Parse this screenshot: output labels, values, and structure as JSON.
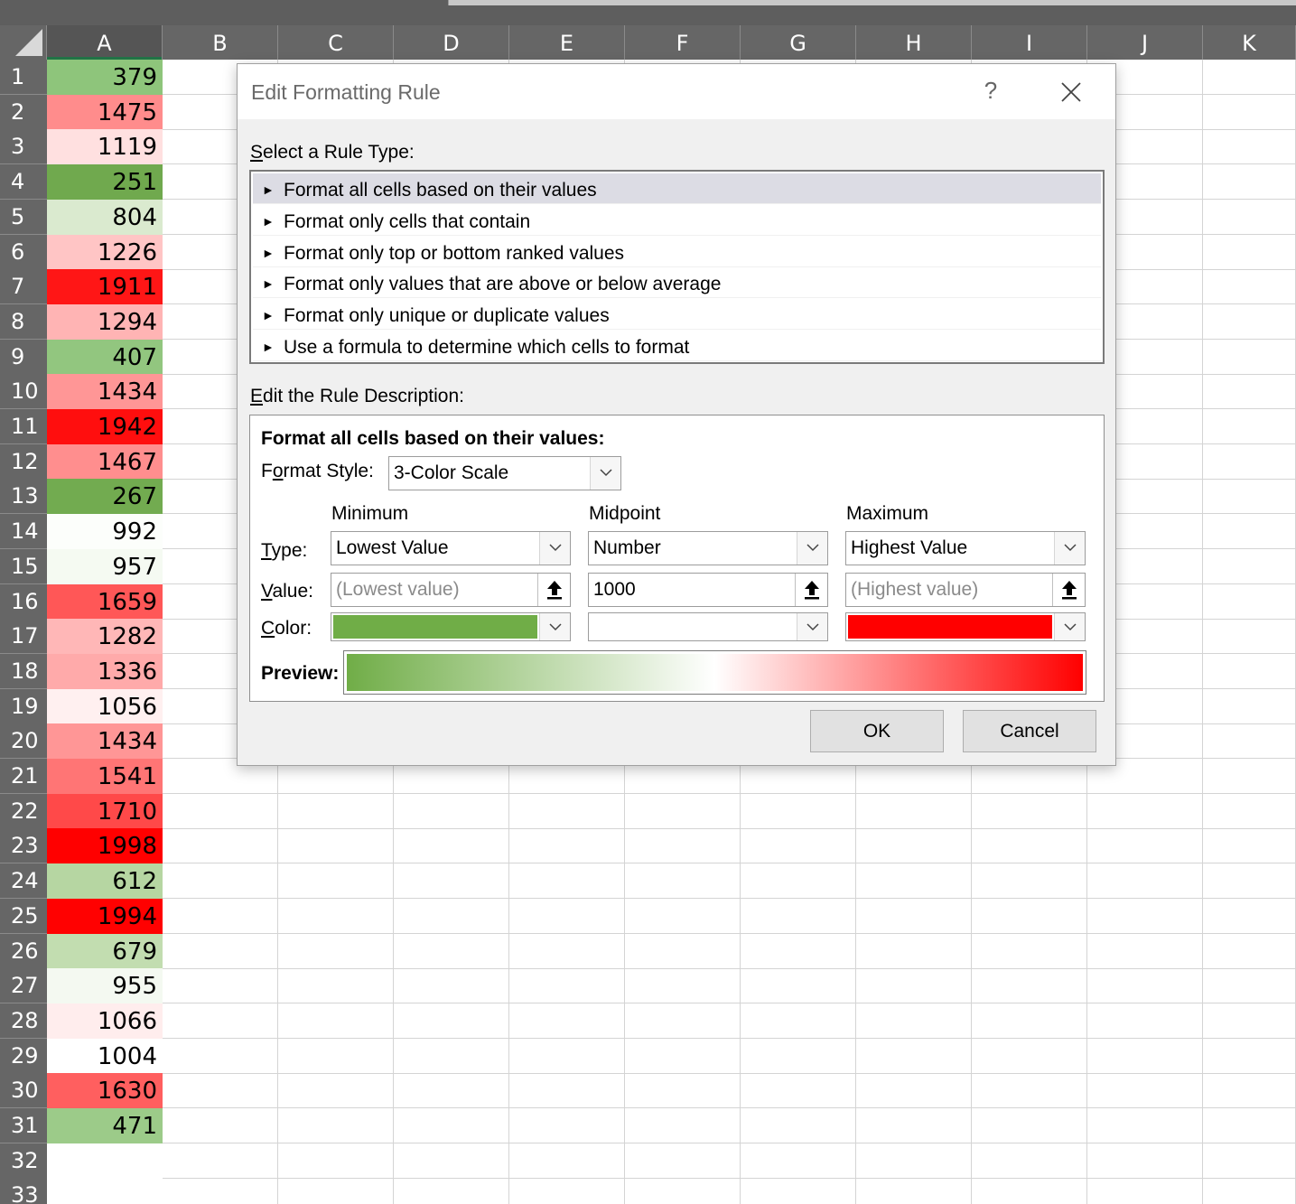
{
  "spreadsheet": {
    "columns": [
      "A",
      "B",
      "C",
      "D",
      "E",
      "F",
      "G",
      "H",
      "I",
      "J",
      "K"
    ],
    "rows": [
      {
        "n": "1",
        "value": "379",
        "color": "#8ec57b"
      },
      {
        "n": "2",
        "value": "1475",
        "color": "#ff8c8c"
      },
      {
        "n": "3",
        "value": "1119",
        "color": "#ffe0e0"
      },
      {
        "n": "4",
        "value": "251",
        "color": "#70a94e"
      },
      {
        "n": "5",
        "value": "804",
        "color": "#daeacf"
      },
      {
        "n": "6",
        "value": "1226",
        "color": "#ffc5c5"
      },
      {
        "n": "7",
        "value": "1911",
        "color": "#ff1616"
      },
      {
        "n": "8",
        "value": "1294",
        "color": "#ffb4b4"
      },
      {
        "n": "9",
        "value": "407",
        "color": "#92c67f"
      },
      {
        "n": "10",
        "value": "1434",
        "color": "#ff9696"
      },
      {
        "n": "11",
        "value": "1942",
        "color": "#ff0e0e"
      },
      {
        "n": "12",
        "value": "1467",
        "color": "#ff8e8e"
      },
      {
        "n": "13",
        "value": "267",
        "color": "#72ab50"
      },
      {
        "n": "14",
        "value": "992",
        "color": "#fcfefb"
      },
      {
        "n": "15",
        "value": "957",
        "color": "#f5faf2"
      },
      {
        "n": "16",
        "value": "1659",
        "color": "#ff5757"
      },
      {
        "n": "17",
        "value": "1282",
        "color": "#ffb7b7"
      },
      {
        "n": "18",
        "value": "1336",
        "color": "#ffaaaa"
      },
      {
        "n": "19",
        "value": "1056",
        "color": "#fff0f0"
      },
      {
        "n": "20",
        "value": "1434",
        "color": "#ff9696"
      },
      {
        "n": "21",
        "value": "1541",
        "color": "#ff7575"
      },
      {
        "n": "22",
        "value": "1710",
        "color": "#ff4949"
      },
      {
        "n": "23",
        "value": "1998",
        "color": "#ff0000"
      },
      {
        "n": "24",
        "value": "612",
        "color": "#b6d6a2"
      },
      {
        "n": "25",
        "value": "1994",
        "color": "#ff0101"
      },
      {
        "n": "26",
        "value": "679",
        "color": "#c2ddb0"
      },
      {
        "n": "27",
        "value": "955",
        "color": "#f4f9f1"
      },
      {
        "n": "28",
        "value": "1066",
        "color": "#ffeded"
      },
      {
        "n": "29",
        "value": "1004",
        "color": "#ffffff"
      },
      {
        "n": "30",
        "value": "1630",
        "color": "#ff5f5f"
      },
      {
        "n": "31",
        "value": "471",
        "color": "#9ccb89"
      },
      {
        "n": "32",
        "value": "",
        "color": "#ffffff"
      },
      {
        "n": "33",
        "value": "",
        "color": "#ffffff"
      }
    ]
  },
  "dialog": {
    "title": "Edit Formatting Rule",
    "help": "?",
    "rule_type_label_key": "S",
    "rule_type_label_rest": "elect a Rule Type:",
    "rule_types": [
      "Format all cells based on their values",
      "Format only cells that contain",
      "Format only top or bottom ranked values",
      "Format only values that are above or below average",
      "Format only unique or duplicate values",
      "Use a formula to determine which cells to format"
    ],
    "selected_rule_index": 0,
    "description_label_key": "E",
    "description_label_rest": "dit the Rule Description:",
    "description_title": "Format all cells based on their values:",
    "format_style_label_pre": "F",
    "format_style_label_key": "o",
    "format_style_label_rest": "rmat Style:",
    "format_style_value": "3-Color Scale",
    "headers": {
      "minimum": "Minimum",
      "midpoint": "Midpoint",
      "maximum": "Maximum"
    },
    "type_label_key": "T",
    "type_label_rest": "ype:",
    "value_label_key": "V",
    "value_label_rest": "alue:",
    "color_label_key": "C",
    "color_label_rest": "olor:",
    "minimum": {
      "type": "Lowest Value",
      "value": "(Lowest value)",
      "color": "#70ad47"
    },
    "midpoint": {
      "type": "Number",
      "value": "1000",
      "color": "#ffffff"
    },
    "maximum": {
      "type": "Highest Value",
      "value": "(Highest value)",
      "color": "#ff0000"
    },
    "preview_label": "Preview:",
    "ok_label": "OK",
    "cancel_label": "Cancel"
  }
}
